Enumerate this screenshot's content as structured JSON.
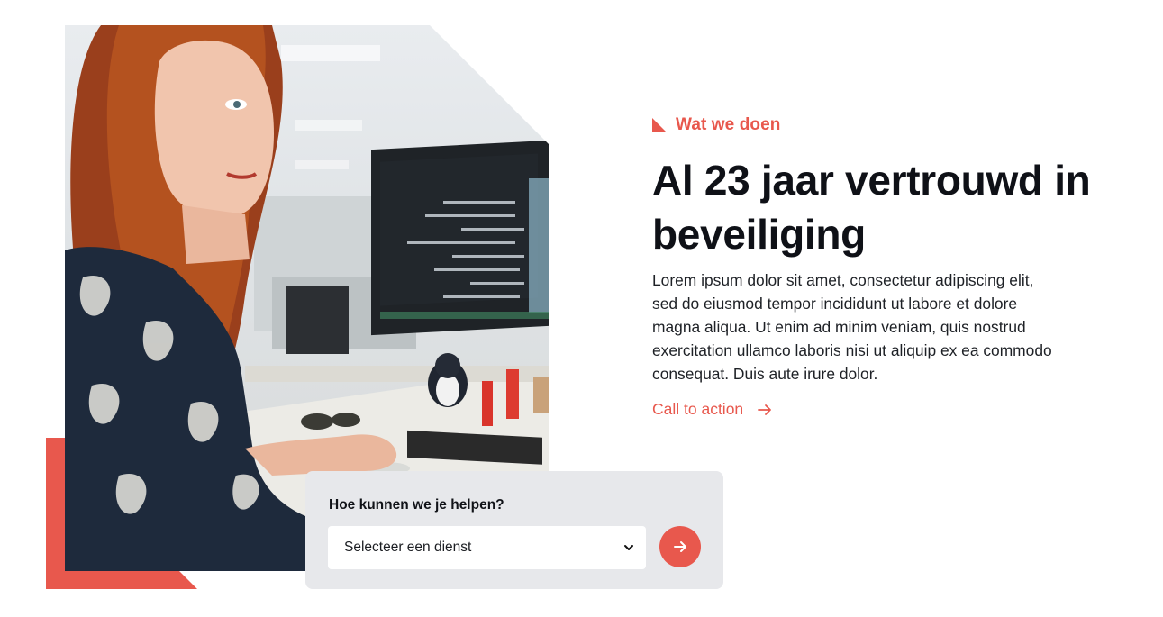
{
  "hero": {
    "eyebrow": "Wat we doen",
    "headline": "Al 23 jaar vertrouwd in beveiliging",
    "body": "Lorem ipsum dolor sit amet, consectetur adipiscing elit, sed do eiusmod tempor incididunt ut labore et dolore magna aliqua. Ut enim ad minim veniam, quis nostrud exercitation ullamco laboris nisi ut aliquip ex ea commodo consequat. Duis aute irure dolor.",
    "cta_label": "Call to action"
  },
  "help": {
    "title": "Hoe kunnen we je helpen?",
    "select_value": "Selecteer een dienst"
  },
  "icons": {
    "eyebrow": "triangle-corner-icon",
    "cta": "arrow-right-icon",
    "select": "chevron-down-icon",
    "submit": "arrow-right-icon"
  },
  "colors": {
    "accent": "#e8584d",
    "heading": "#0f1117",
    "panel_bg": "#e7e8eb"
  }
}
